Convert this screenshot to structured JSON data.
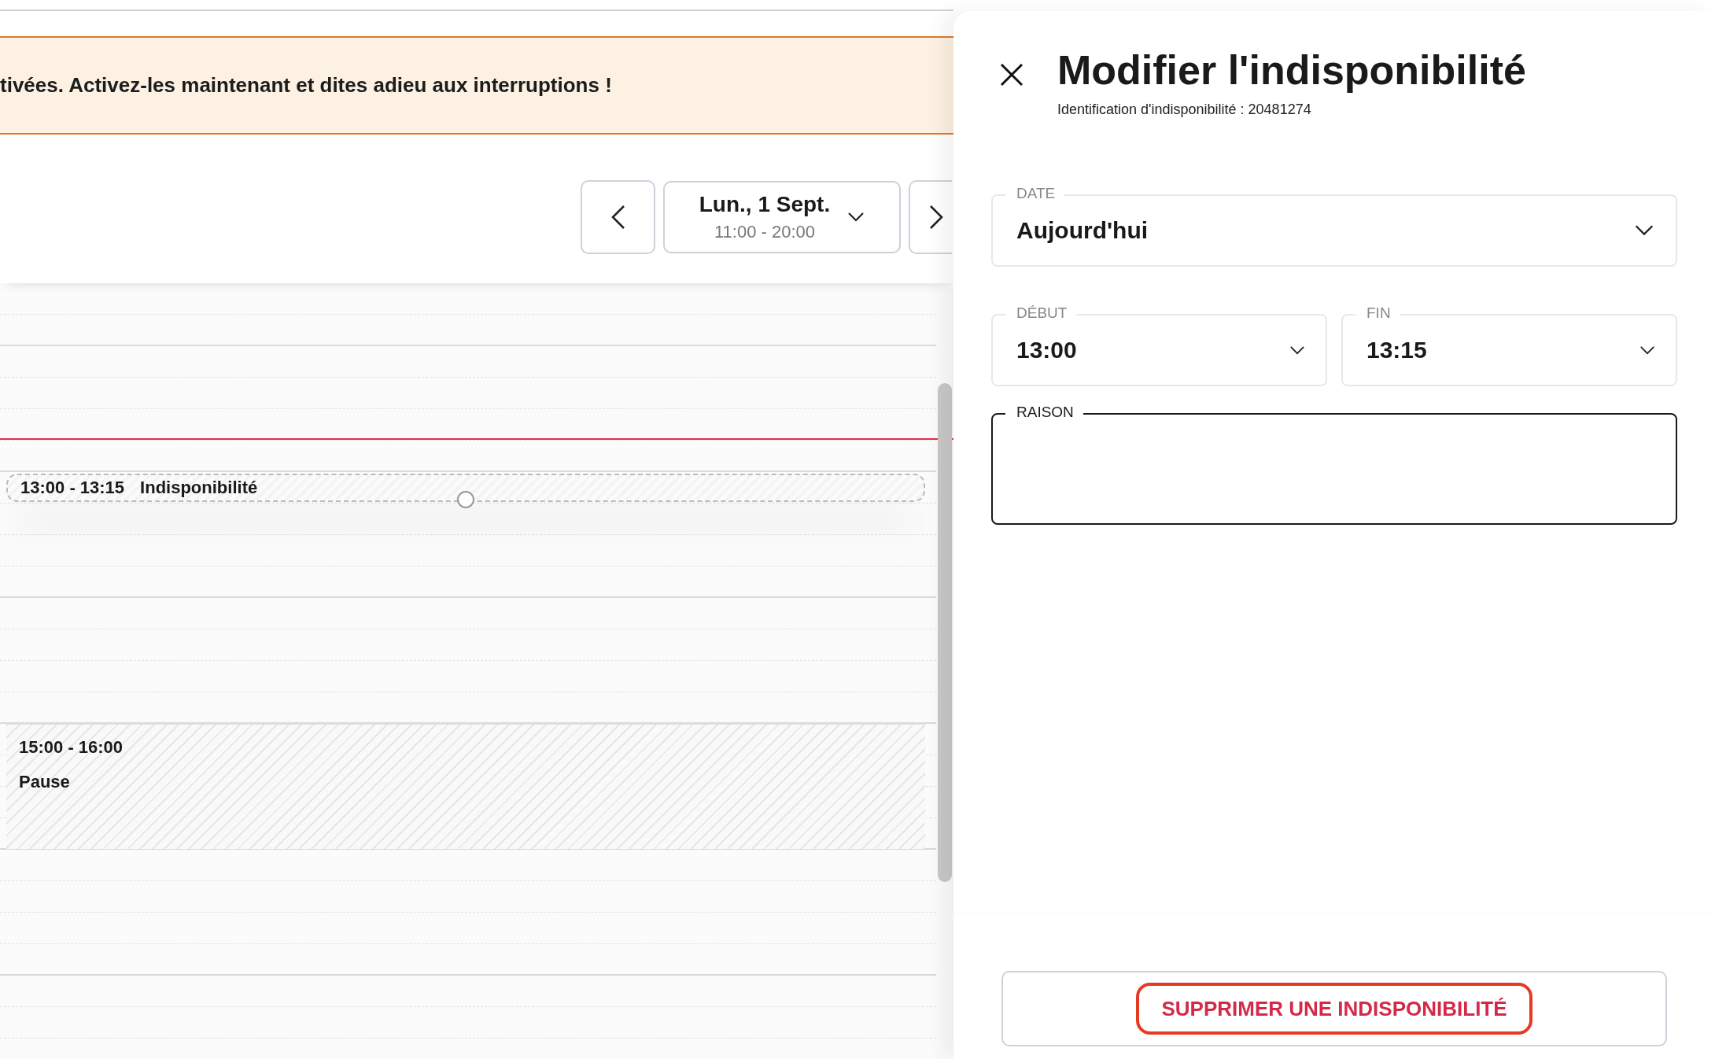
{
  "banner": {
    "text": "tivées. Activez-les maintenant et dites adieu aux interruptions !"
  },
  "date_nav": {
    "date": "Lun., 1 Sept.",
    "hours": "11:00 - 20:00"
  },
  "events": [
    {
      "kind": "unavailability",
      "time": "13:00 - 13:15",
      "title": "Indisponibilité",
      "selected": true
    },
    {
      "kind": "break",
      "time": "15:00 - 16:00",
      "title": "Pause",
      "selected": false
    }
  ],
  "panel": {
    "title": "Modifier l'indisponibilité",
    "subtitle": "Identification d'indisponibilité : 20481274",
    "fields": [
      {
        "kind": "select",
        "label": "DATE",
        "value": "Aujourd'hui",
        "focused": false
      },
      {
        "kind": "select",
        "label": "DÉBUT",
        "value": "13:00",
        "focused": false
      },
      {
        "kind": "select",
        "label": "FIN",
        "value": "13:15",
        "focused": false
      },
      {
        "kind": "textarea",
        "label": "RAISON",
        "focused": true
      }
    ],
    "delete_button": "SUPPRIMER UNE INDISPONIBILITÉ"
  }
}
